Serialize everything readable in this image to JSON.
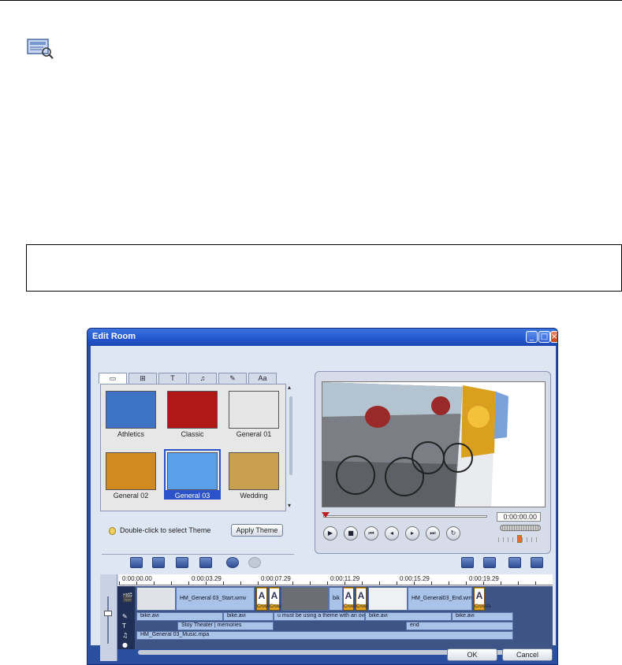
{
  "window": {
    "title": "Edit Room",
    "min_glyph": "_",
    "max_glyph": "□",
    "close_glyph": "×"
  },
  "library": {
    "tabs": [
      "▭",
      "⊞",
      "T",
      "♫",
      "✎",
      "Aa"
    ],
    "themes": [
      {
        "label": "Athletics",
        "color": "#3d74c8"
      },
      {
        "label": "Classic",
        "color": "#b01818"
      },
      {
        "label": "General 01",
        "color": "#e6e6e6"
      },
      {
        "label": "General 02",
        "color": "#d08a20"
      },
      {
        "label": "General 03",
        "color": "#5aa0e8",
        "selected": true
      },
      {
        "label": "Wedding",
        "color": "#c8a050"
      }
    ],
    "scroll_up": "▴",
    "scroll_down": "▾",
    "hint": "Double-click to select Theme",
    "apply_label": "Apply Theme"
  },
  "preview": {
    "timecode": "0:00:00.00",
    "controls": [
      "▶",
      "■",
      "⏮",
      "◂",
      "▸",
      "⏭",
      "↻"
    ]
  },
  "timeline": {
    "ruler_labels": [
      "0:00:00.00",
      "0:00:03.29",
      "0:00:07.29",
      "0:00:11.29",
      "0:00:15.29",
      "0:00:19.29"
    ],
    "track_icons": [
      "🎬",
      "✎",
      "T",
      "♫",
      "●"
    ],
    "video_clips": [
      {
        "label": ""
      },
      {
        "label": "HM_General 03_Start.wmv"
      },
      {
        "label": ""
      },
      {
        "label": "bik"
      },
      {
        "label": ""
      },
      {
        "label": "HM_General03_End.wm"
      }
    ],
    "transition_label": "Crossfa",
    "transition_glyph": "A",
    "overlay_clips": [
      {
        "label": "bike.avi"
      },
      {
        "label": "bike.avi"
      },
      {
        "label": "u must be using a theme with an over"
      },
      {
        "label": "bike.avi"
      },
      {
        "label": "bike.avi"
      }
    ],
    "title_clips": [
      {
        "label": "Stoy Theater | memories"
      },
      {
        "label": "end"
      }
    ],
    "music_clip": {
      "label": "HM_General 03_Music.mpa"
    }
  },
  "dialog": {
    "ok_label": "OK",
    "cancel_label": "Cancel"
  }
}
